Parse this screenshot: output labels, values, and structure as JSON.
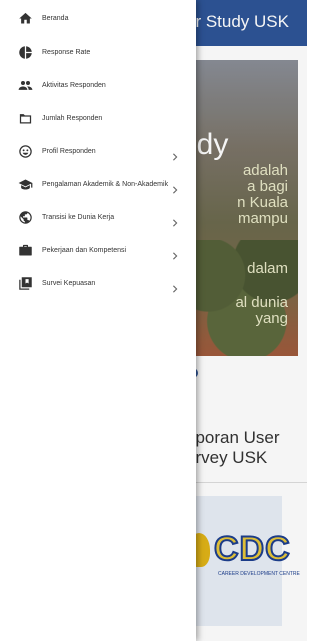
{
  "background_page": {
    "title": "er Study USK",
    "hero": {
      "heading": "udy",
      "lines": [
        "adalah",
        "a  bagi",
        "n Kuala",
        "mampu",
        "dalam",
        "al dunia",
        "yang"
      ]
    },
    "report_title_lines": [
      "aporan User",
      "urvey USK"
    ],
    "logo": {
      "letters": "CDC",
      "subtitle": "CAREER DEVELOPMENT CENTRE"
    }
  },
  "drawer": {
    "items": [
      {
        "label": "Beranda",
        "icon": "home-icon",
        "has_submenu": false
      },
      {
        "label": "Response Rate",
        "icon": "pie-chart-icon",
        "has_submenu": false
      },
      {
        "label": "Aktivitas Responden",
        "icon": "group-icon",
        "has_submenu": false
      },
      {
        "label": "Jumlah Responden",
        "icon": "folder-icon",
        "has_submenu": false
      },
      {
        "label": "Profil Responden",
        "icon": "smile-icon",
        "has_submenu": true
      },
      {
        "label": "Pengalaman Akademik & Non-Akademik",
        "icon": "graduation-cap-icon",
        "has_submenu": true
      },
      {
        "label": "Transisi ke Dunia Kerja",
        "icon": "globe-icon",
        "has_submenu": true
      },
      {
        "label": "Pekerjaan dan Kompetensi",
        "icon": "briefcase-icon",
        "has_submenu": true
      },
      {
        "label": "Survei Kepuasan",
        "icon": "library-icon",
        "has_submenu": true
      }
    ]
  },
  "colors": {
    "brand": "#2e5597",
    "icon": "#333333",
    "text": "#333333"
  }
}
